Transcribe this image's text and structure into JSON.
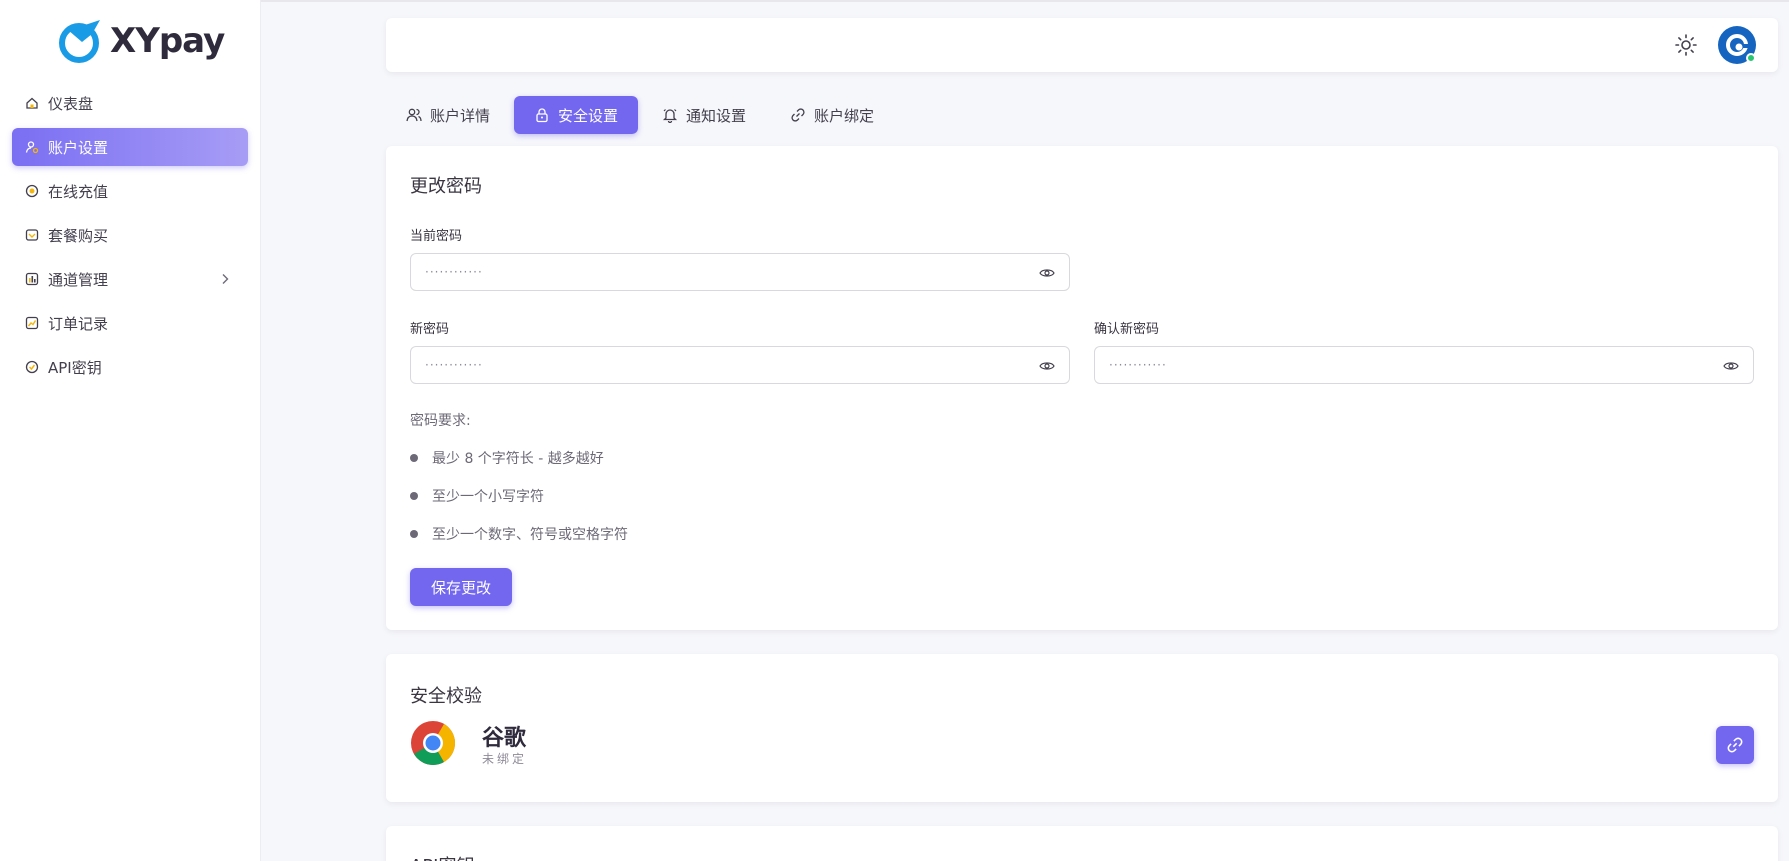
{
  "brand": {
    "name": "XYpay"
  },
  "sidebar": {
    "items": [
      {
        "label": "仪表盘",
        "icon": "home-icon"
      },
      {
        "label": "账户设置",
        "icon": "user-settings-icon",
        "active": true
      },
      {
        "label": "在线充值",
        "icon": "coin-icon"
      },
      {
        "label": "套餐购买",
        "icon": "package-icon"
      },
      {
        "label": "通道管理",
        "icon": "chart-bar-icon",
        "has_submenu": true
      },
      {
        "label": "订单记录",
        "icon": "trend-icon"
      },
      {
        "label": "API密钥",
        "icon": "key-icon"
      }
    ]
  },
  "header": {
    "theme_icon": "sun-icon",
    "avatar_status": "online"
  },
  "tabs": [
    {
      "label": "账户详情",
      "icon": "users-icon"
    },
    {
      "label": "安全设置",
      "icon": "lock-icon",
      "active": true
    },
    {
      "label": "通知设置",
      "icon": "bell-icon"
    },
    {
      "label": "账户绑定",
      "icon": "link-icon"
    }
  ],
  "password_card": {
    "title": "更改密码",
    "current_label": "当前密码",
    "current_placeholder": "············",
    "new_label": "新密码",
    "new_placeholder": "············",
    "confirm_label": "确认新密码",
    "confirm_placeholder": "············",
    "requirements_title": "密码要求:",
    "requirements": [
      "最少 8 个字符长 - 越多越好",
      "至少一个小写字符",
      "至少一个数字、符号或空格字符"
    ],
    "save_label": "保存更改"
  },
  "security_card": {
    "title": "安全校验",
    "provider_name": "谷歌",
    "provider_status": "未绑定"
  },
  "api_card": {
    "title": "API密钥"
  },
  "colors": {
    "primary": "#7367f0",
    "background": "#f6f7fb"
  }
}
